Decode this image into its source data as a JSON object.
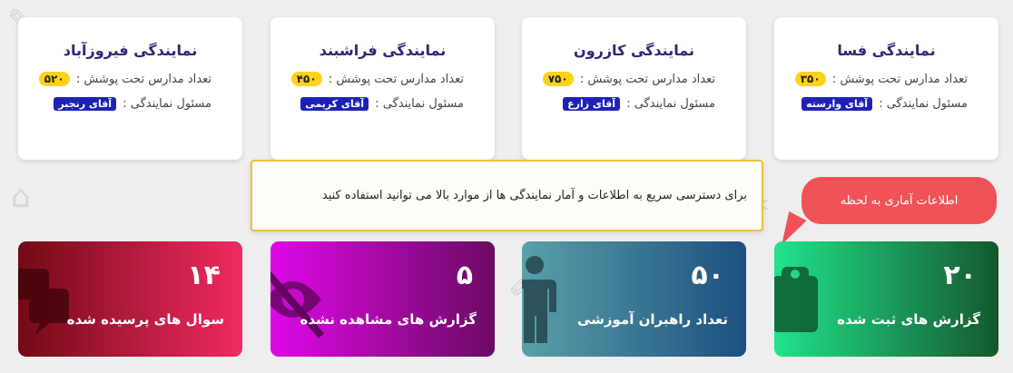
{
  "agencies": [
    {
      "title": "نمایندگی فسا",
      "count_label": "تعداد مدارس تحت پوشش :",
      "count": "۳۵۰",
      "manager_label": "مسئول نمایندگی :",
      "manager": "آقای وارسته"
    },
    {
      "title": "نمایندگی کازرون",
      "count_label": "تعداد مدارس تحت پوشش :",
      "count": "۷۵۰",
      "manager_label": "مسئول نمایندگی :",
      "manager": "آقای زارع"
    },
    {
      "title": "نمایندگی فراشبند",
      "count_label": "تعداد مدارس تحت پوشش :",
      "count": "۴۵۰",
      "manager_label": "مسئول نمایندگی :",
      "manager": "آقای کریمی"
    },
    {
      "title": "نمایندگی فیروزآباد",
      "count_label": "تعداد مدارس تحت پوشش :",
      "count": "۵۲۰",
      "manager_label": "مسئول نمایندگی :",
      "manager": "آقای رنجبر"
    }
  ],
  "info_text": "برای دسترسی سریع به اطلاعات و آمار نمایندگی ها از موارد بالا می توانید استفاده کنید",
  "tooltip_text": "اطلاعات آماری به لحظه",
  "stats": [
    {
      "number": "۲۰",
      "label": "گزارش های ثبت شده",
      "icon": "clipboard-icon",
      "gradient": [
        "#14582c",
        "#22e28c"
      ]
    },
    {
      "number": "۵۰",
      "label": "تعداد راهبران آموزشی",
      "icon": "person-icon",
      "gradient": [
        "#1c4f80",
        "#5aa0a8"
      ]
    },
    {
      "number": "۵",
      "label": "گزارش های مشاهده نشده",
      "icon": "eye-slash-icon",
      "gradient": [
        "#6c0a63",
        "#df08e8"
      ]
    },
    {
      "number": "۱۴",
      "label": "سوال های پرسیده شده",
      "icon": "comments-icon",
      "gradient": [
        "#f02a62",
        "#730a16"
      ]
    }
  ]
}
